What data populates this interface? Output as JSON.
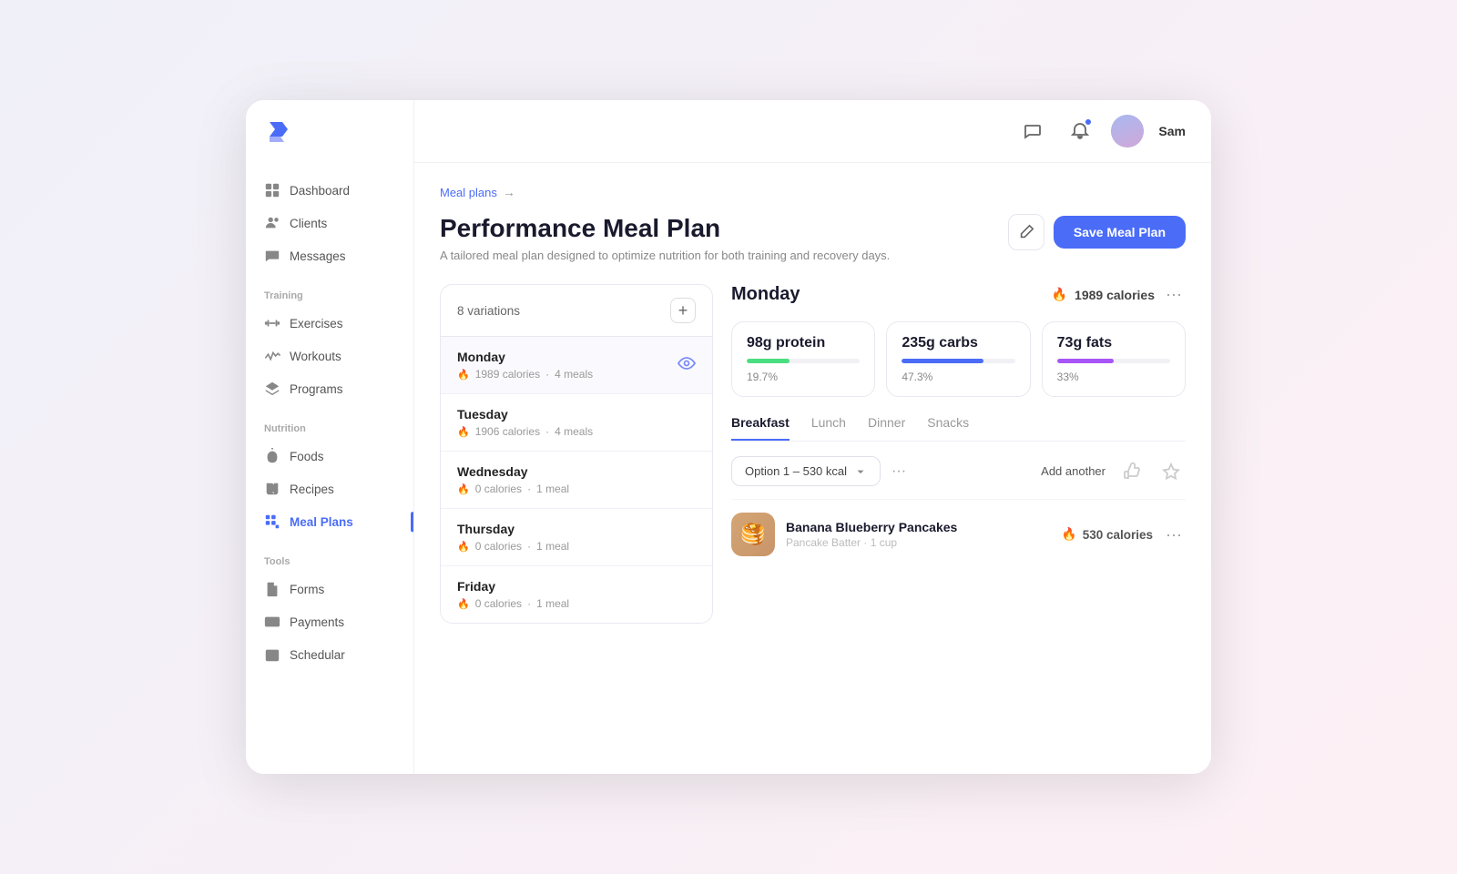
{
  "app": {
    "logo_text": "F"
  },
  "sidebar": {
    "nav_items": [
      {
        "id": "dashboard",
        "label": "Dashboard",
        "icon": "grid",
        "active": false,
        "section": ""
      },
      {
        "id": "clients",
        "label": "Clients",
        "icon": "users",
        "active": false,
        "section": ""
      },
      {
        "id": "messages",
        "label": "Messages",
        "icon": "message",
        "active": false,
        "section": ""
      }
    ],
    "training_label": "Training",
    "training_items": [
      {
        "id": "exercises",
        "label": "Exercises",
        "icon": "dumbbell",
        "active": false
      },
      {
        "id": "workouts",
        "label": "Workouts",
        "icon": "activity",
        "active": false
      },
      {
        "id": "programs",
        "label": "Programs",
        "icon": "layers",
        "active": false
      }
    ],
    "nutrition_label": "Nutrition",
    "nutrition_items": [
      {
        "id": "foods",
        "label": "Foods",
        "icon": "apple",
        "active": false
      },
      {
        "id": "recipes",
        "label": "Recipes",
        "icon": "book",
        "active": false
      },
      {
        "id": "mealplans",
        "label": "Meal Plans",
        "icon": "grid2",
        "active": true
      }
    ],
    "tools_label": "Tools",
    "tools_items": [
      {
        "id": "forms",
        "label": "Forms",
        "icon": "file",
        "active": false
      },
      {
        "id": "payments",
        "label": "Payments",
        "icon": "credit-card",
        "active": false
      },
      {
        "id": "schedular",
        "label": "Schedular",
        "icon": "calendar",
        "active": false
      }
    ]
  },
  "header": {
    "user_name": "Sam"
  },
  "breadcrumb": {
    "link_text": "Meal plans",
    "arrow": "→"
  },
  "page": {
    "title": "Performance Meal Plan",
    "subtitle": "A tailored meal plan designed to optimize nutrition for both training and recovery days.",
    "save_label": "Save Meal Plan"
  },
  "left_panel": {
    "variations_label": "8 variations",
    "days": [
      {
        "name": "Monday",
        "calories": "1989 calories",
        "meals": "4 meals",
        "active": true,
        "show_eye": true
      },
      {
        "name": "Tuesday",
        "calories": "1906 calories",
        "meals": "4 meals",
        "active": false,
        "show_eye": false
      },
      {
        "name": "Wednesday",
        "calories": "0 calories",
        "meals": "1 meal",
        "active": false,
        "show_eye": false
      },
      {
        "name": "Thursday",
        "calories": "0 calories",
        "meals": "1 meal",
        "active": false,
        "show_eye": false
      },
      {
        "name": "Friday",
        "calories": "0 calories",
        "meals": "1 meal",
        "active": false,
        "show_eye": false
      }
    ]
  },
  "right_panel": {
    "day_title": "Monday",
    "day_calories": "1989 calories",
    "macros": [
      {
        "label": "protein",
        "value": "98g protein",
        "bar_pct": 38,
        "bar_color": "#4ade80",
        "pct_text": "19.7%"
      },
      {
        "label": "carbs",
        "value": "235g carbs",
        "bar_pct": 72,
        "bar_color": "#4a6cf7",
        "pct_text": "47.3%"
      },
      {
        "label": "fats",
        "value": "73g fats",
        "bar_pct": 50,
        "bar_color": "#a855f7",
        "pct_text": "33%"
      }
    ],
    "tabs": [
      {
        "id": "breakfast",
        "label": "Breakfast",
        "active": true
      },
      {
        "id": "lunch",
        "label": "Lunch",
        "active": false
      },
      {
        "id": "dinner",
        "label": "Dinner",
        "active": false
      },
      {
        "id": "snacks",
        "label": "Snacks",
        "active": false
      }
    ],
    "option_label": "Option 1 – 530 kcal",
    "add_another_label": "Add another",
    "food_item": {
      "name": "Banana Blueberry Pancakes",
      "sub": "Pancake Batter · 1 cup",
      "calories": "530 calories",
      "emoji": "🥞"
    }
  }
}
